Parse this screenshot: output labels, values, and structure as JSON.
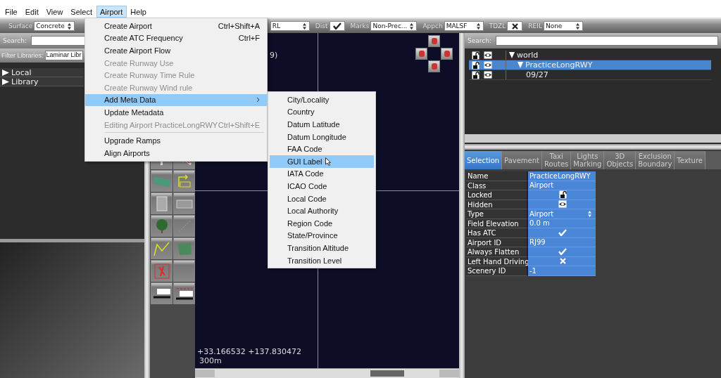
{
  "menubar": [
    {
      "label": "File",
      "selected": false
    },
    {
      "label": "Edit",
      "selected": false
    },
    {
      "label": "View",
      "selected": false
    },
    {
      "label": "Select",
      "selected": false
    },
    {
      "label": "Airport",
      "selected": true
    },
    {
      "label": "Help",
      "selected": false
    }
  ],
  "toolbar": [
    {
      "kind": "select",
      "label": "Surface",
      "value": "Concrete"
    },
    {
      "kind": "select",
      "value": "RL"
    },
    {
      "kind": "check",
      "label": "Dist",
      "checked": true
    },
    {
      "kind": "select",
      "label": "Marks",
      "value": "Non-Prec..."
    },
    {
      "kind": "select",
      "label": "Appch",
      "value": "MALSF"
    },
    {
      "kind": "check",
      "label": "TDZL",
      "checked": false
    },
    {
      "kind": "select",
      "label": "REIL",
      "value": "None"
    }
  ],
  "library": {
    "search_label": "Search:",
    "filter_label": "Filter Libraries:",
    "filter_value": "Laminar Libr",
    "items": [
      {
        "label": "Local",
        "expanded": false
      },
      {
        "label": "Library",
        "expanded": false
      }
    ]
  },
  "map": {
    "label": "9)",
    "coordinates": "+33.166532 +137.830472",
    "scale": "300m"
  },
  "hierarchy": {
    "search_label": "Search:",
    "rows": [
      {
        "label": "world",
        "expanded": true,
        "selected": false,
        "children": [
          {
            "label": "PracticeLongRWY",
            "expanded": true,
            "selected": true,
            "children": [
              {
                "label": "09/27",
                "selected": false
              }
            ]
          }
        ]
      }
    ]
  },
  "tabs": [
    {
      "label": "Selection",
      "selected": true
    },
    {
      "label": "Pavement",
      "selected": false
    },
    {
      "label": "Taxi Routes",
      "selected": false
    },
    {
      "label": "Lights Marking",
      "selected": false
    },
    {
      "label": "3D Objects",
      "selected": false
    },
    {
      "label": "Exclusion Boundary",
      "selected": false
    },
    {
      "label": "Texture",
      "selected": false
    }
  ],
  "properties": [
    {
      "name": "Name",
      "kind": "text",
      "value": "PracticeLongRWY"
    },
    {
      "name": "Class",
      "kind": "text",
      "value": "Airport"
    },
    {
      "name": "Locked",
      "kind": "lock",
      "checked": false
    },
    {
      "name": "Hidden",
      "kind": "eye",
      "checked": false
    },
    {
      "name": "Type",
      "kind": "select",
      "value": "Airport"
    },
    {
      "name": "Field Elevation",
      "kind": "text",
      "value": "0.0 m"
    },
    {
      "name": "Has ATC",
      "kind": "check",
      "checked": true
    },
    {
      "name": "Airport ID",
      "kind": "text",
      "value": "RJ99"
    },
    {
      "name": "Always Flatten",
      "kind": "check",
      "checked": true
    },
    {
      "name": "Left Hand Driving",
      "kind": "check",
      "checked": false
    },
    {
      "name": "Scenery ID",
      "kind": "text",
      "value": "-1"
    }
  ],
  "airport_menu": [
    {
      "kind": "item",
      "label": "Create Airport",
      "shortcut": "Ctrl+Shift+A",
      "disabled": false
    },
    {
      "kind": "item",
      "label": "Create ATC Frequency",
      "shortcut": "Ctrl+F",
      "disabled": false
    },
    {
      "kind": "item",
      "label": "Create Airport Flow",
      "disabled": false
    },
    {
      "kind": "item",
      "label": "Create Runway Use",
      "disabled": true
    },
    {
      "kind": "item",
      "label": "Create Runway Time Rule",
      "disabled": true
    },
    {
      "kind": "item",
      "label": "Create Runway Wind rule",
      "disabled": true
    },
    {
      "kind": "submenu",
      "label": "Add Meta Data",
      "selected": true
    },
    {
      "kind": "item",
      "label": "Update Metadata",
      "disabled": false
    },
    {
      "kind": "item",
      "label": "Editing Airport PracticeLongRWY",
      "shortcut": "Ctrl+Shift+E",
      "disabled": true
    },
    {
      "kind": "separator"
    },
    {
      "kind": "item",
      "label": "Upgrade Ramps",
      "disabled": false
    },
    {
      "kind": "item",
      "label": "Align Airports",
      "disabled": false
    }
  ],
  "meta_submenu": [
    {
      "label": "City/Locality",
      "selected": false
    },
    {
      "label": "Country",
      "selected": false
    },
    {
      "label": "Datum Latitude",
      "selected": false
    },
    {
      "label": "Datum Longitude",
      "selected": false
    },
    {
      "label": "FAA Code",
      "selected": false
    },
    {
      "label": "GUI Label",
      "selected": true
    },
    {
      "label": "IATA Code",
      "selected": false
    },
    {
      "label": "ICAO Code",
      "selected": false
    },
    {
      "label": "Local Code",
      "selected": false
    },
    {
      "label": "Local Authority",
      "selected": false
    },
    {
      "label": "Region Code",
      "selected": false
    },
    {
      "label": "State/Province",
      "selected": false
    },
    {
      "label": "Transition Altitude",
      "selected": false
    },
    {
      "label": "Transition Level",
      "selected": false
    }
  ]
}
